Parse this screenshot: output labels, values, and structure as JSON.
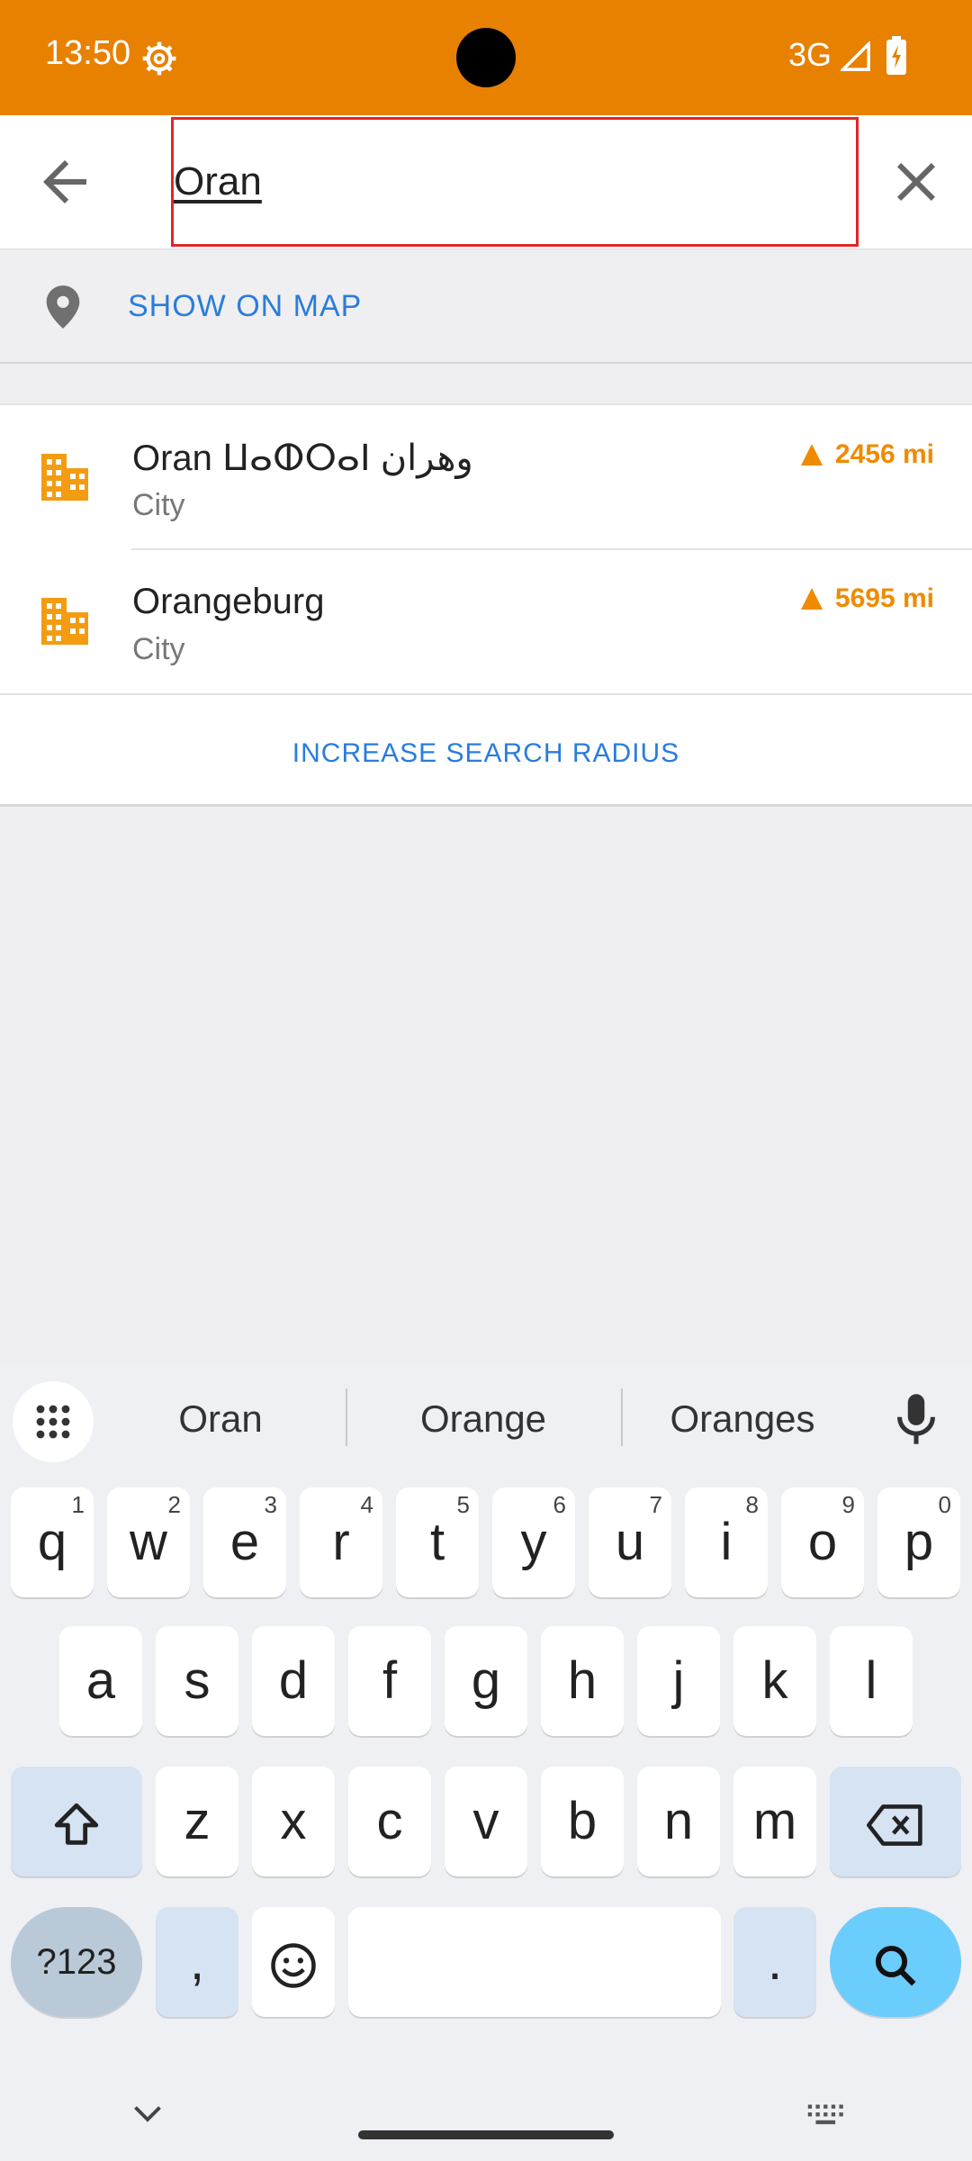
{
  "status_bar": {
    "time": "13:50",
    "network": "3G",
    "bg_color": "#e88000"
  },
  "search": {
    "query": "Oran"
  },
  "show_on_map": {
    "label": "SHOW ON MAP"
  },
  "results": [
    {
      "title": "Oran ⵡⴰⵀⵔⴰⵏ وهران",
      "subtitle": "City",
      "distance": "2456 mi"
    },
    {
      "title": "Orangeburg",
      "subtitle": "City",
      "distance": "5695 mi"
    }
  ],
  "increase_radius": {
    "label": "INCREASE SEARCH RADIUS"
  },
  "keyboard": {
    "suggestions": [
      "Oran",
      "Orange",
      "Oranges"
    ],
    "row1": [
      {
        "k": "q",
        "n": "1"
      },
      {
        "k": "w",
        "n": "2"
      },
      {
        "k": "e",
        "n": "3"
      },
      {
        "k": "r",
        "n": "4"
      },
      {
        "k": "t",
        "n": "5"
      },
      {
        "k": "y",
        "n": "6"
      },
      {
        "k": "u",
        "n": "7"
      },
      {
        "k": "i",
        "n": "8"
      },
      {
        "k": "o",
        "n": "9"
      },
      {
        "k": "p",
        "n": "0"
      }
    ],
    "row2": [
      "a",
      "s",
      "d",
      "f",
      "g",
      "h",
      "j",
      "k",
      "l"
    ],
    "row3": [
      "z",
      "x",
      "c",
      "v",
      "b",
      "n",
      "m"
    ],
    "symbols_label": "?123",
    "comma": ",",
    "period": "."
  },
  "colors": {
    "accent": "#e88000",
    "link": "#2a7ddb",
    "distance": "#f08a00"
  }
}
